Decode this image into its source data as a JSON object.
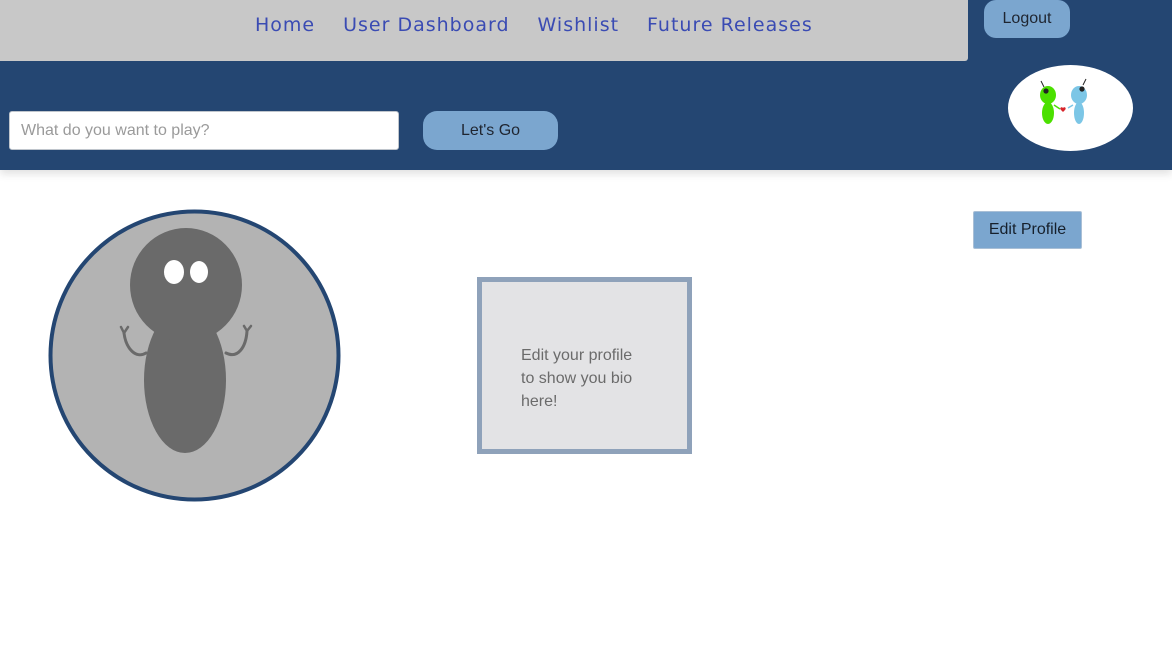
{
  "nav": {
    "items": [
      {
        "label": "Home"
      },
      {
        "label": "User Dashboard"
      },
      {
        "label": "Wishlist"
      },
      {
        "label": "Future Releases"
      }
    ],
    "logout_label": "Logout"
  },
  "search": {
    "placeholder": "What do you want to play?",
    "value": "",
    "button_label": "Let's Go"
  },
  "logo": {
    "icon": "two-alien-characters-logo"
  },
  "profile": {
    "avatar_icon": "default-avatar-figure",
    "bio_placeholder": "Edit your profile to show you bio here!",
    "edit_label": "Edit Profile"
  },
  "colors": {
    "header_blue": "#244672",
    "nav_gray": "#c8c8c8",
    "nav_link": "#3a4bb3",
    "button_blue": "#7ba6cf",
    "bio_border": "#8fa2ba",
    "bio_background": "#e3e3e5",
    "avatar_background": "#b3b3b3",
    "avatar_figure": "#6a6a6a"
  }
}
